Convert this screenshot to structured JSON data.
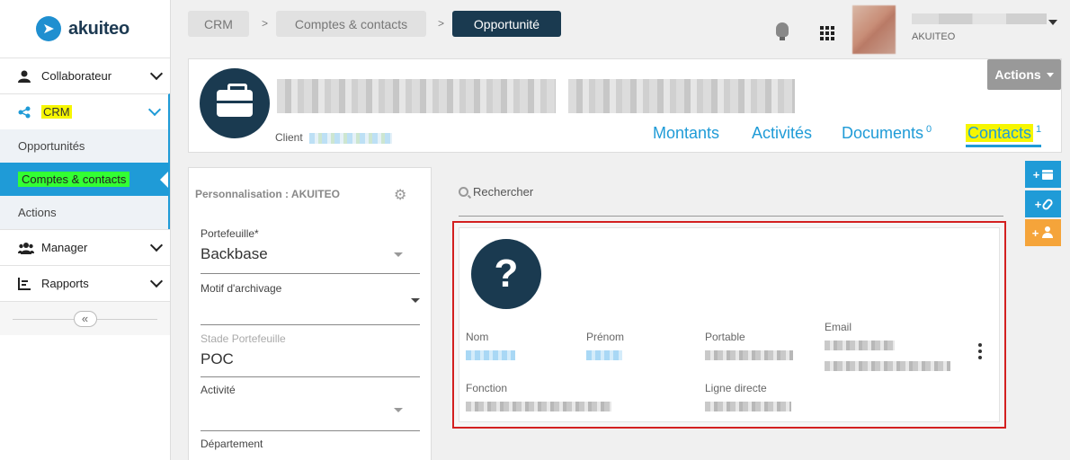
{
  "brand": {
    "name": "akuiteo",
    "color": "#1f9bd7",
    "dark": "#1a3a50"
  },
  "sidebar": {
    "items": [
      {
        "label": "Collaborateur",
        "icon": "user-icon"
      },
      {
        "label": "CRM",
        "icon": "share-icon"
      },
      {
        "label": "Manager",
        "icon": "group-icon"
      },
      {
        "label": "Rapports",
        "icon": "report-icon"
      }
    ],
    "crm_subitems": [
      "Opportunités",
      "Comptes & contacts",
      "Actions"
    ],
    "collapse_glyph": "«"
  },
  "breadcrumb": {
    "items": [
      "CRM",
      "Comptes & contacts",
      "Opportunité"
    ],
    "separator": ">"
  },
  "user": {
    "company": "AKUITEO"
  },
  "header": {
    "client_label": "Client",
    "actions_label": "Actions",
    "tabs": [
      {
        "label": "Montants",
        "count": ""
      },
      {
        "label": "Activités",
        "count": ""
      },
      {
        "label": "Documents",
        "count": "0"
      },
      {
        "label": "Contacts",
        "count": "1"
      }
    ]
  },
  "left_panel": {
    "title": "Personnalisation : AKUITEO",
    "fields": [
      {
        "label": "Portefeuille*",
        "value": "Backbase"
      },
      {
        "label": "Motif d'archivage",
        "value": ""
      },
      {
        "label": "Stade Portefeuille",
        "value": "POC"
      },
      {
        "label": "Activité",
        "value": ""
      },
      {
        "label": "Département",
        "value": ""
      }
    ]
  },
  "search": {
    "placeholder": "Rechercher"
  },
  "contact_card": {
    "avatar_glyph": "?",
    "labels": {
      "nom": "Nom",
      "prenom": "Prénom",
      "portable": "Portable",
      "email": "Email",
      "fonction": "Fonction",
      "ligne_directe": "Ligne directe"
    }
  },
  "side_buttons": {
    "plus": "+"
  }
}
